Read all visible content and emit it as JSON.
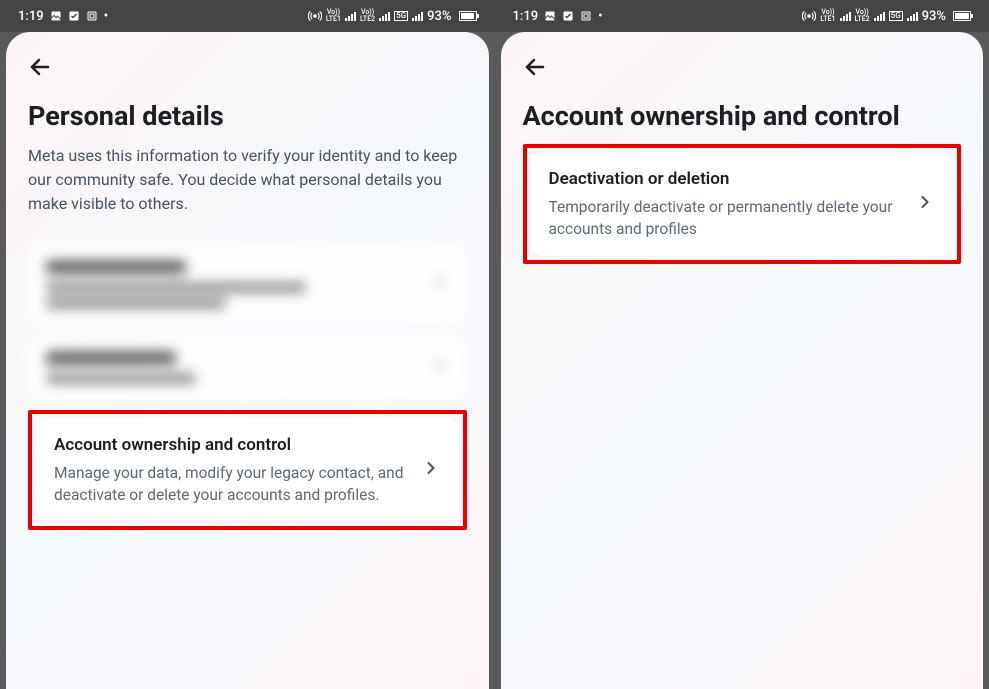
{
  "status": {
    "time": "1:19",
    "battery_pct": "93%",
    "network_label_1": "Vo)) LTE1",
    "network_label_2": "Vo)) LTE2",
    "network_5g": "5G"
  },
  "left": {
    "title": "Personal details",
    "description": "Meta uses this information to verify your identity and to keep our community safe. You decide what personal details you make visible to others.",
    "blurred_contact": {
      "title": "Contact info",
      "line1": "example@gmail.com,",
      "line2": "+0000000000"
    },
    "blurred_dob": {
      "title": "Date of birth",
      "line1": "00 Month 0000"
    },
    "account_ownership": {
      "title": "Account ownership and control",
      "subtitle": "Manage your data, modify your legacy contact, and deactivate or delete your accounts and profiles."
    }
  },
  "right": {
    "title": "Account ownership and control",
    "deactivation": {
      "title": "Deactivation or deletion",
      "subtitle": "Temporarily deactivate or permanently delete your accounts and profiles"
    }
  }
}
